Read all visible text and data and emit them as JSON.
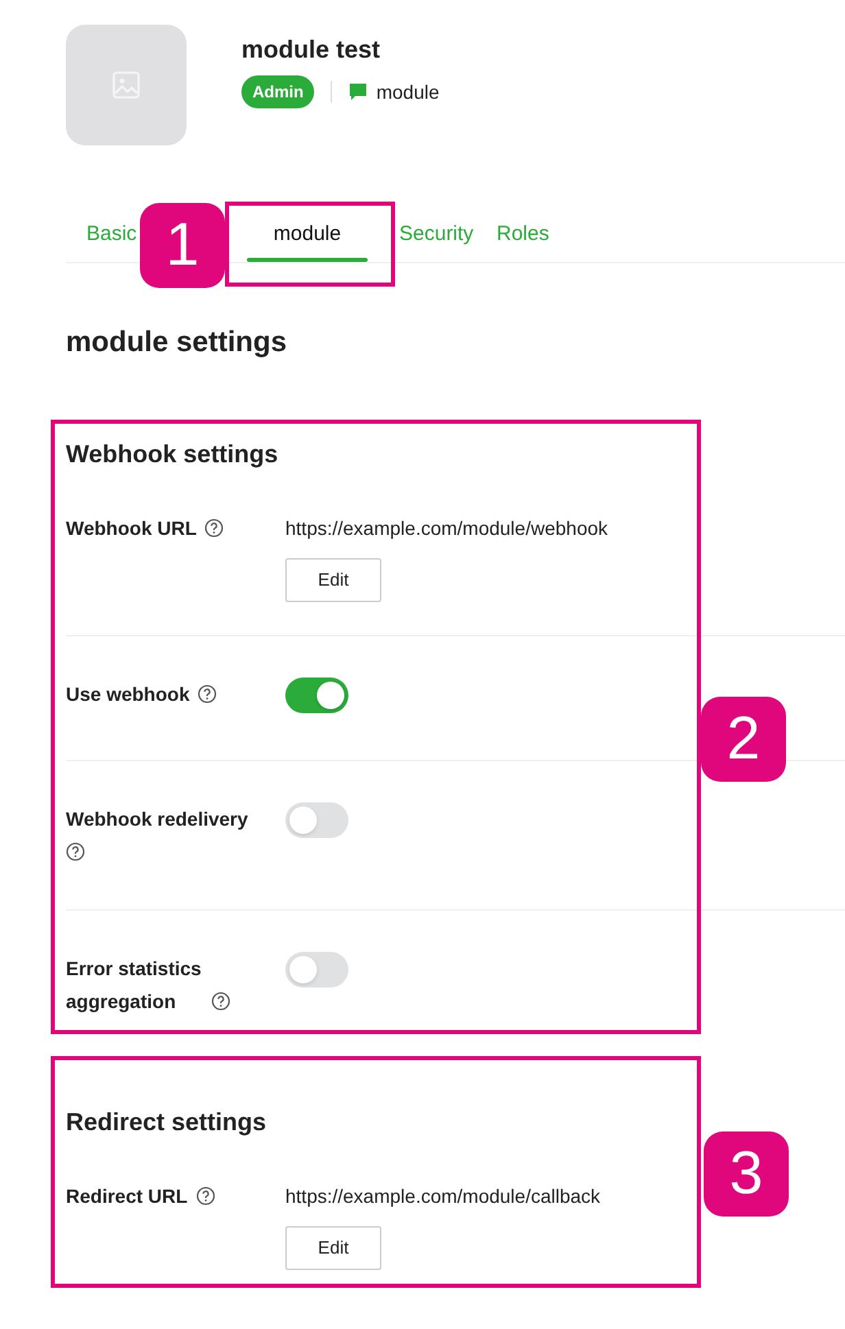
{
  "header": {
    "title": "module test",
    "role_badge": "Admin",
    "channel": "module"
  },
  "tabs": [
    {
      "label": "Basic",
      "selected": false
    },
    {
      "label": "module",
      "selected": true
    },
    {
      "label": "Security",
      "selected": false
    },
    {
      "label": "Roles",
      "selected": false
    }
  ],
  "heading": "module settings",
  "sections": [
    {
      "title": "Webhook settings",
      "rows": [
        {
          "kind": "url",
          "label": "Webhook URL",
          "value": "https://example.com/module/webhook",
          "button": "Edit"
        },
        {
          "kind": "toggle",
          "label": "Use webhook",
          "on": true
        },
        {
          "kind": "toggle",
          "label": "Webhook redelivery",
          "on": false
        },
        {
          "kind": "toggle",
          "label": "Error statistics aggregation",
          "on": false
        }
      ]
    },
    {
      "title": "Redirect settings",
      "rows": [
        {
          "kind": "url",
          "label": "Redirect URL",
          "value": "https://example.com/module/callback",
          "button": "Edit"
        }
      ]
    }
  ],
  "callouts": [
    "1",
    "2",
    "3"
  ]
}
